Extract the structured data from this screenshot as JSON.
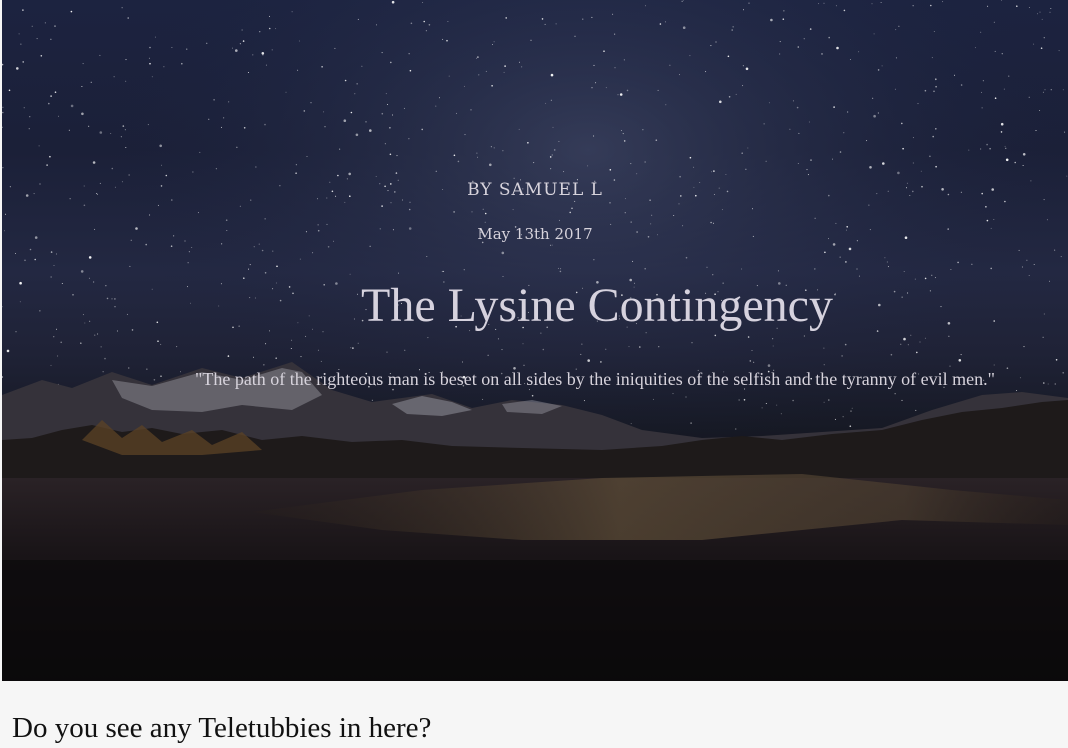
{
  "hero": {
    "byline": "BY SAMUEL L",
    "date": "May 13th 2017",
    "title": "The Lysine Contingency",
    "quote": "\"The path of the righteous man is beset on all sides by the iniquities of the selfish and the tyranny of evil men.\"",
    "background": "starry-night-mountain-photo"
  },
  "article": {
    "section_heading": "Do you see any Teletubbies in here?"
  }
}
